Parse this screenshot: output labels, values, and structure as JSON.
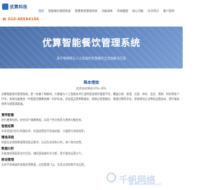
{
  "header": {
    "logo_text": "优算科技",
    "phone": "010-88594166",
    "nav": [
      "首页",
      "智能餐饮管理系统",
      "智慧食堂管理系统",
      "功能清单",
      "系统截图",
      "核心功能",
      "技术亮点",
      "客户案例"
    ]
  },
  "hero": {
    "title": "优算智能餐饮管理系统",
    "subtitle": "基于物联网与人工智能的智慧餐饮全流程解决方案"
  },
  "metric": {
    "title": "降本增效",
    "value": "综合成本降低10%-30%"
  },
  "intro": "优算智能餐饮管理系统，是一款基于物联网、大数据与人工智能技术打造的智慧餐饮管理平台，覆盖点餐、收银、后厨、库存、会员、营销、财务等各个环节。系统深度融合（中国居民膳食指南）科学标准，实现菜品营养数据化、就餐过程智能化、管理决策科学化，帮助餐饮企业降低运营成本、提升服务效率与顾客满意度。",
  "features": [
    {
      "title": "营养配餐",
      "desc": "依托膳食指南，结合用户健康数据，实现个性化推荐与营养均衡配餐。"
    },
    {
      "title": "智能结算",
      "desc": "采用视觉识别与称重技术，托盘放置即可秒级结算，大幅提升就餐效率。"
    },
    {
      "title": "精准采购",
      "desc": "根据历史销售数据预测菜品需求，自动生成采购计划，减少食材浪费。"
    },
    {
      "title": "数据分析",
      "desc": "多维度经营报表实时呈现，辅助管理者科学决策，提升整体运营水平。"
    },
    {
      "title": "移动管理",
      "desc": "支持手机端随时查看经营数据，远程管理门店，实现全流程数字化运营。"
    }
  ],
  "watermark": {
    "text": "千帆网络",
    "sub": "qianfanwangluo.com"
  }
}
